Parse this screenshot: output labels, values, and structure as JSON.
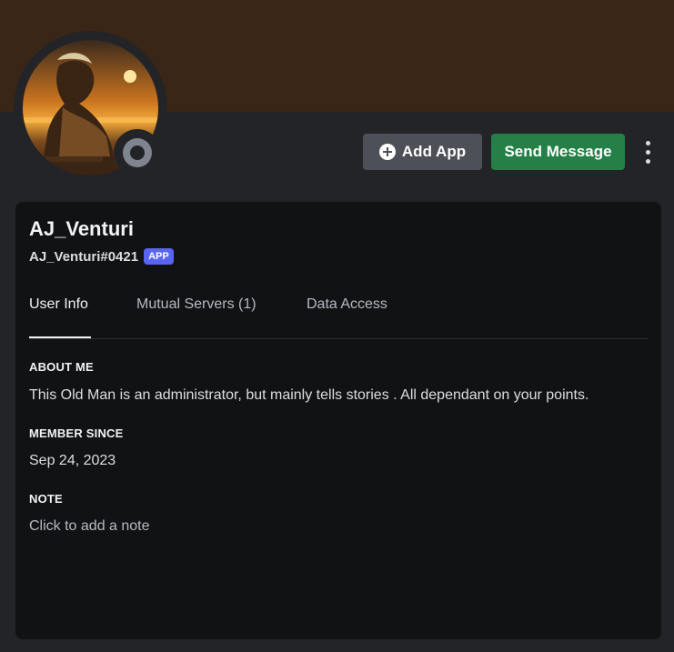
{
  "profile": {
    "display_name": "AJ_Venturi",
    "tag": "AJ_Venturi#0421",
    "badge": "APP",
    "status": "offline"
  },
  "actions": {
    "add_app": "Add App",
    "send_message": "Send Message"
  },
  "tabs": [
    {
      "label": "User Info",
      "active": true
    },
    {
      "label": "Mutual Servers (1)",
      "active": false
    },
    {
      "label": "Data Access",
      "active": false
    }
  ],
  "about": {
    "heading": "ABOUT ME",
    "text": "This Old Man is an administrator, but mainly tells stories . All dependant on your points."
  },
  "member_since": {
    "heading": "MEMBER SINCE",
    "text": "Sep 24, 2023"
  },
  "note": {
    "heading": "NOTE",
    "placeholder": "Click to add a note"
  },
  "colors": {
    "banner": "#3a2616",
    "background": "#232428",
    "card": "#111214",
    "send_button": "#248046",
    "badge": "#5865f2"
  }
}
